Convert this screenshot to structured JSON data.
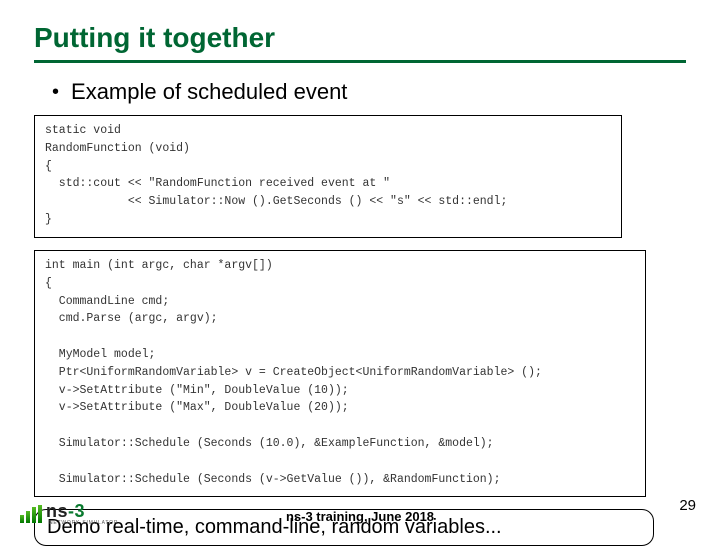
{
  "title": "Putting it together",
  "bullet": "Example of scheduled event",
  "code1": "static void\nRandomFunction (void)\n{\n  std::cout << \"RandomFunction received event at \"\n            << Simulator::Now ().GetSeconds () << \"s\" << std::endl;\n}",
  "code2": "int main (int argc, char *argv[])\n{\n  CommandLine cmd;\n  cmd.Parse (argc, argv);\n\n  MyModel model;\n  Ptr<UniformRandomVariable> v = CreateObject<UniformRandomVariable> ();\n  v->SetAttribute (\"Min\", DoubleValue (10));\n  v->SetAttribute (\"Max\", DoubleValue (20));\n\n  Simulator::Schedule (Seconds (10.0), &ExampleFunction, &model);\n\n  Simulator::Schedule (Seconds (v->GetValue ()), &RandomFunction);",
  "demo": "Demo real-time, command-line, random variables...",
  "footer": "ns-3 training, June 2018",
  "page": "29",
  "logo": {
    "ns": "ns",
    "dash3": "-3",
    "sub": "NETWORK SIMULATOR"
  }
}
